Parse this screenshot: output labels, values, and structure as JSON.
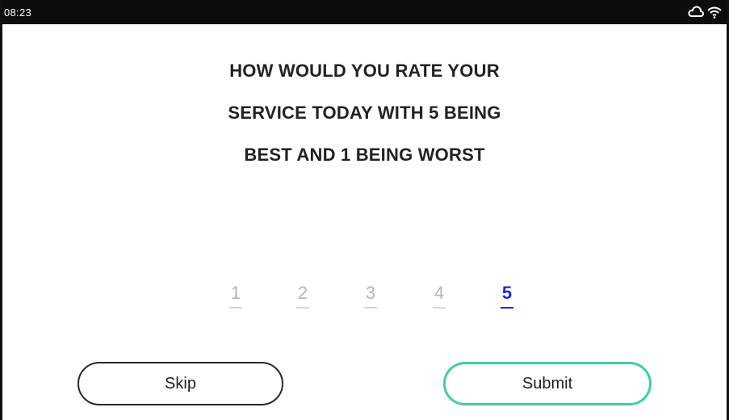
{
  "status_bar": {
    "time": "08:23",
    "icons": [
      "cloud-icon",
      "wifi-icon"
    ]
  },
  "question": {
    "lines": [
      "HOW WOULD YOU RATE YOUR",
      "SERVICE TODAY WITH 5 BEING",
      "BEST AND 1 BEING WORST"
    ]
  },
  "ratings": {
    "options": [
      "1",
      "2",
      "3",
      "4",
      "5"
    ],
    "selected": "5",
    "colors": {
      "selected": "#1a2bd6",
      "unselected": "#b4b4b4"
    }
  },
  "actions": {
    "skip_label": "Skip",
    "submit_label": "Submit",
    "submit_border_color": "#3ed09a"
  }
}
